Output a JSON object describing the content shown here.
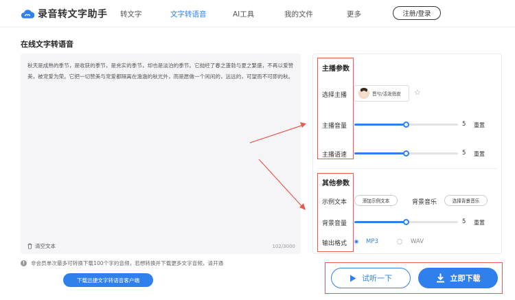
{
  "header": {
    "logo_text": "录音转文字助手",
    "nav": [
      "转文字",
      "文字转语音",
      "AI工具",
      "我的文件",
      "更多"
    ],
    "login_label": "注册/登录"
  },
  "page_title": "在线文字转语音",
  "editor": {
    "text": "秋天是成熟的季节，是收获的季节，是充实的季节，却也是淡泊的季节。它抛经了春之蓬勃与夏之繁盛，不再以爱赞美，被宠爱为荣。它把一切赞美与宠爱都隔离在澹澹的秋光外，而是愿做一个闲闲的，远远的，可望而不可即的秋。",
    "clear_label": "清空文本",
    "char_count": "102/3000"
  },
  "notice_text": "非会员单次最多可转换下载100个字的音频，若想转换并下载更多文字音频，请开通",
  "download_client_label": "下载迅捷文字转语音客户端",
  "anchor_params": {
    "title": "主播参数",
    "select_label": "选择主播",
    "anchor_name": "晋兮/活泼俏皮",
    "volume_label": "主播音量",
    "volume_value": "5",
    "volume_fraction": 0.5,
    "speed_label": "主播语速",
    "speed_value": "5",
    "speed_fraction": 0.5,
    "reset_label": "重置"
  },
  "other_params": {
    "title": "其他参数",
    "sample_label": "示例文本",
    "sample_btn": "添加示例文本",
    "bgm_label": "背景音乐",
    "bgm_btn": "选择背景音乐",
    "bg_volume_label": "背景音量",
    "bg_volume_value": "5",
    "bg_volume_fraction": 0.5,
    "format_label": "输出格式",
    "format_options": [
      "MP3",
      "WAV"
    ],
    "format_selected": "MP3"
  },
  "actions": {
    "try_label": "试听一下",
    "download_label": "立即下载"
  },
  "colors": {
    "accent": "#2f80ed",
    "highlight": "#e85a4f"
  }
}
